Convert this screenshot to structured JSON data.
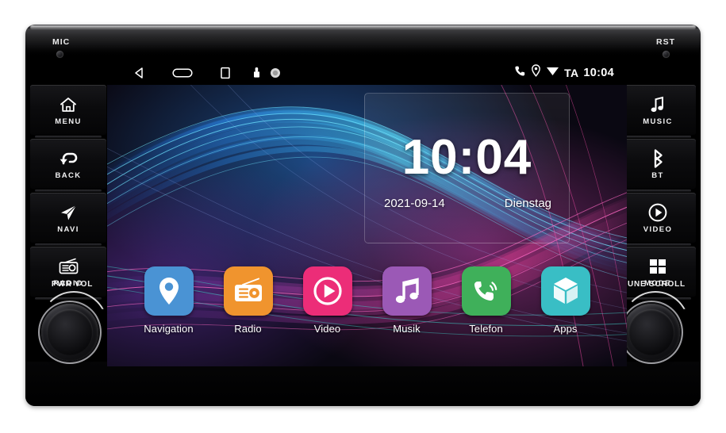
{
  "device": {
    "mic_label": "MIC",
    "reset_label": "RST",
    "left_buttons": [
      {
        "label": "MENU",
        "icon": "home-icon"
      },
      {
        "label": "BACK",
        "icon": "back-arrow-icon"
      },
      {
        "label": "NAVI",
        "icon": "navigation-arrow-icon"
      },
      {
        "label": "RADIO",
        "icon": "radio-icon"
      }
    ],
    "right_buttons": [
      {
        "label": "MUSIC",
        "icon": "music-note-icon"
      },
      {
        "label": "BT",
        "icon": "bluetooth-icon"
      },
      {
        "label": "VIDEO",
        "icon": "play-circle-icon"
      },
      {
        "label": "MODE",
        "icon": "grid-squares-icon"
      }
    ],
    "left_knob_label": "PWR  VOL",
    "right_knob_label": "TUNE  SCROLL"
  },
  "statusbar": {
    "nav": [
      {
        "name": "back-triangle-icon"
      },
      {
        "name": "home-oval-icon"
      },
      {
        "name": "recents-square-icon"
      },
      {
        "name": "lock-icon"
      },
      {
        "name": "record-dot-icon"
      }
    ],
    "system": [
      {
        "name": "phone-icon"
      },
      {
        "name": "location-pin-icon"
      },
      {
        "name": "wifi-icon"
      }
    ],
    "ta_label": "TA",
    "time": "10:04"
  },
  "clock_widget": {
    "time": "10:04",
    "date": "2021-09-14",
    "weekday": "Dienstag"
  },
  "dock": {
    "apps": [
      {
        "label": "Navigation",
        "icon": "location-pin-icon",
        "color": "#4a93d4"
      },
      {
        "label": "Radio",
        "icon": "radio-icon",
        "color": "#f0942e"
      },
      {
        "label": "Video",
        "icon": "play-circle-icon",
        "color": "#ec2d78"
      },
      {
        "label": "Musik",
        "icon": "music-note-icon",
        "color": "#9b59b6"
      },
      {
        "label": "Telefon",
        "icon": "phone-icon",
        "color": "#3fb05a"
      },
      {
        "label": "Apps",
        "icon": "cube-icon",
        "color": "#39bec5"
      }
    ]
  },
  "wallpaper": {
    "name": "abstract-waves-wallpaper",
    "background": "#0a0812",
    "accents": [
      "#2f7fe0",
      "#38c6ef",
      "#c23fa8",
      "#e0459a",
      "#7a4bd0"
    ]
  }
}
